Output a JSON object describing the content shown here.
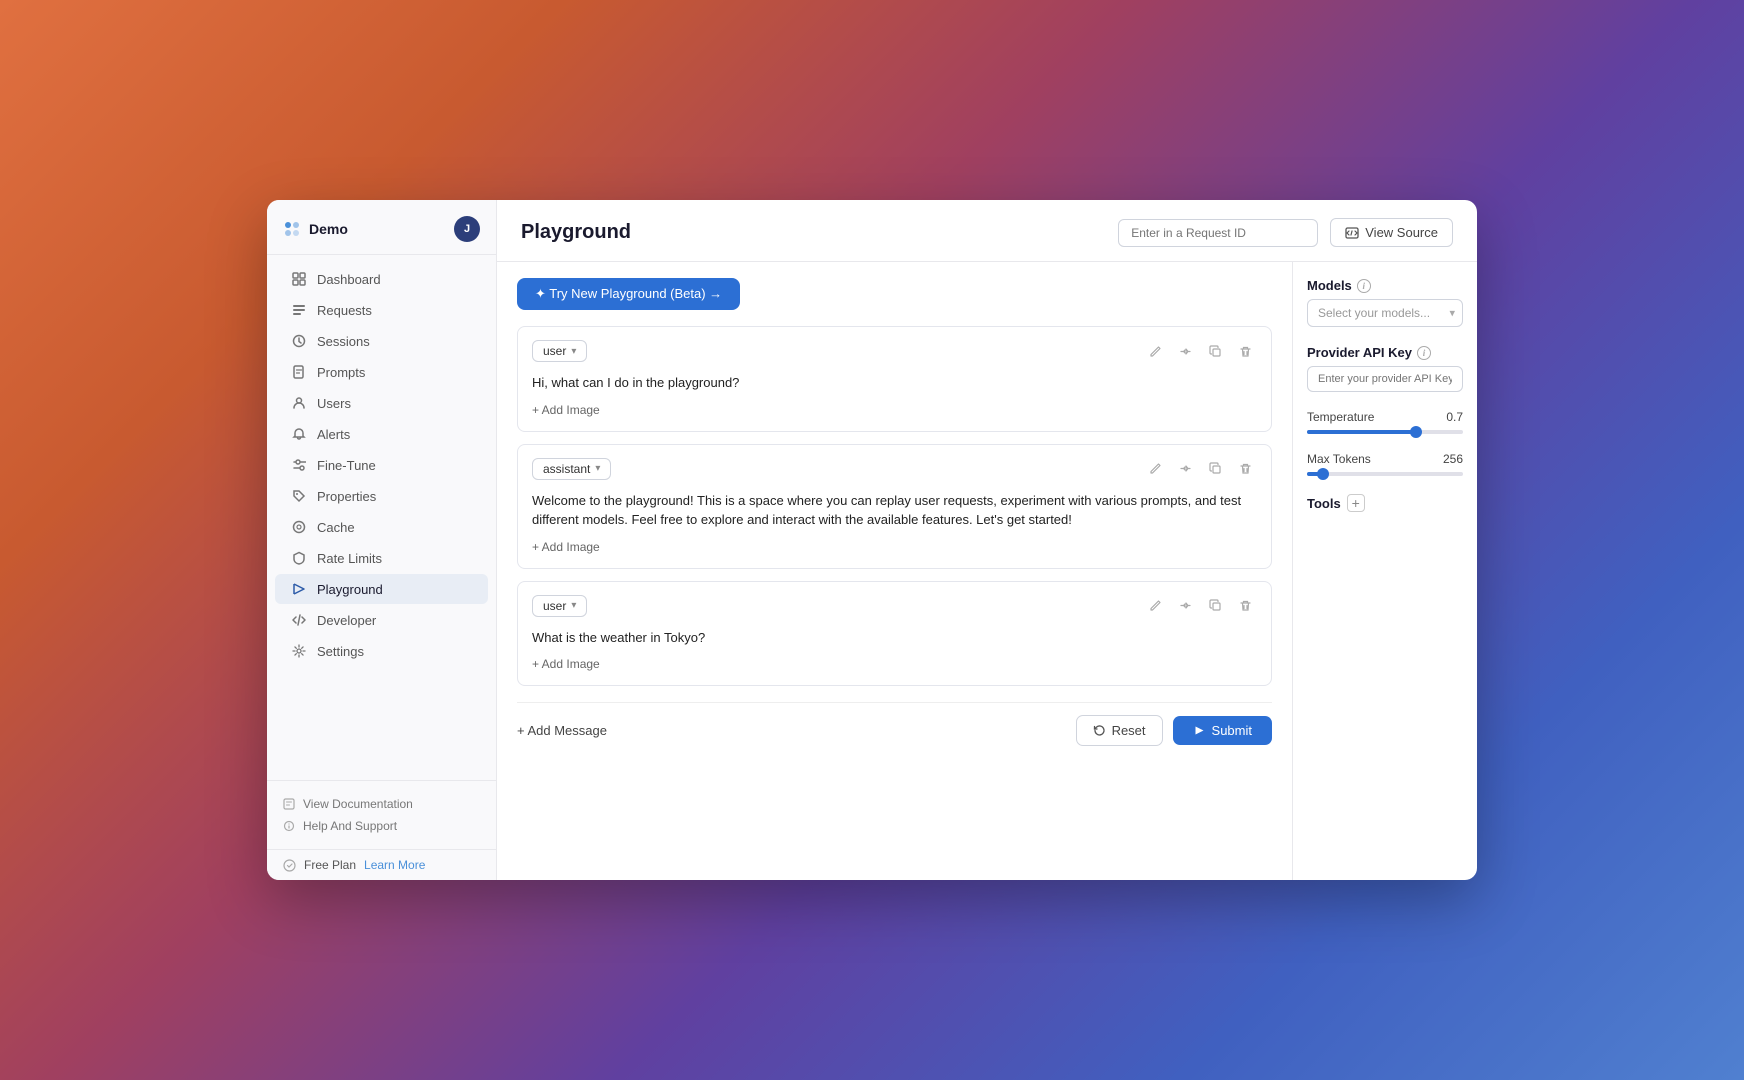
{
  "app": {
    "brand": "Demo",
    "avatar": "J"
  },
  "sidebar": {
    "items": [
      {
        "id": "dashboard",
        "label": "Dashboard",
        "icon": "grid"
      },
      {
        "id": "requests",
        "label": "Requests",
        "icon": "list"
      },
      {
        "id": "sessions",
        "label": "Sessions",
        "icon": "clock"
      },
      {
        "id": "prompts",
        "label": "Prompts",
        "icon": "file"
      },
      {
        "id": "users",
        "label": "Users",
        "icon": "user"
      },
      {
        "id": "alerts",
        "label": "Alerts",
        "icon": "bell"
      },
      {
        "id": "fine-tune",
        "label": "Fine-Tune",
        "icon": "settings2"
      },
      {
        "id": "properties",
        "label": "Properties",
        "icon": "tag"
      },
      {
        "id": "cache",
        "label": "Cache",
        "icon": "circle"
      },
      {
        "id": "rate-limits",
        "label": "Rate Limits",
        "icon": "shield"
      },
      {
        "id": "playground",
        "label": "Playground",
        "icon": "play",
        "active": true
      },
      {
        "id": "developer",
        "label": "Developer",
        "icon": "code"
      },
      {
        "id": "settings",
        "label": "Settings",
        "icon": "gear"
      }
    ],
    "footer": [
      {
        "id": "docs",
        "label": "View Documentation"
      },
      {
        "id": "support",
        "label": "Help And Support"
      }
    ],
    "free_plan_label": "Free Plan",
    "learn_more_label": "Learn More"
  },
  "header": {
    "title": "Playground",
    "request_id_placeholder": "Enter in a Request ID",
    "view_source_label": "View Source"
  },
  "try_new_btn": "✦ Try New Playground (Beta) →",
  "messages": [
    {
      "role": "user",
      "text": "Hi, what can I do in the playground?",
      "add_image_label": "+ Add Image"
    },
    {
      "role": "assistant",
      "text": "Welcome to the playground! This is a space where you can replay user requests, experiment with various prompts, and test different models. Feel free to explore and interact with the available features. Let's get started!",
      "add_image_label": "+ Add Image"
    },
    {
      "role": "user",
      "text": "What is the weather in Tokyo?",
      "add_image_label": "+ Add Image"
    }
  ],
  "footer": {
    "add_message_label": "+ Add Message",
    "reset_label": "Reset",
    "submit_label": "Submit"
  },
  "right_panel": {
    "models_section": "Models",
    "models_placeholder": "Select your models...",
    "provider_key_label": "Provider API Key",
    "provider_key_placeholder": "Enter your provider API Key (optional)",
    "temperature_label": "Temperature",
    "temperature_value": "0.7",
    "temperature_percent": 70,
    "max_tokens_label": "Max Tokens",
    "max_tokens_value": "256",
    "max_tokens_percent": 10,
    "tools_label": "Tools",
    "tools_add": "+"
  }
}
